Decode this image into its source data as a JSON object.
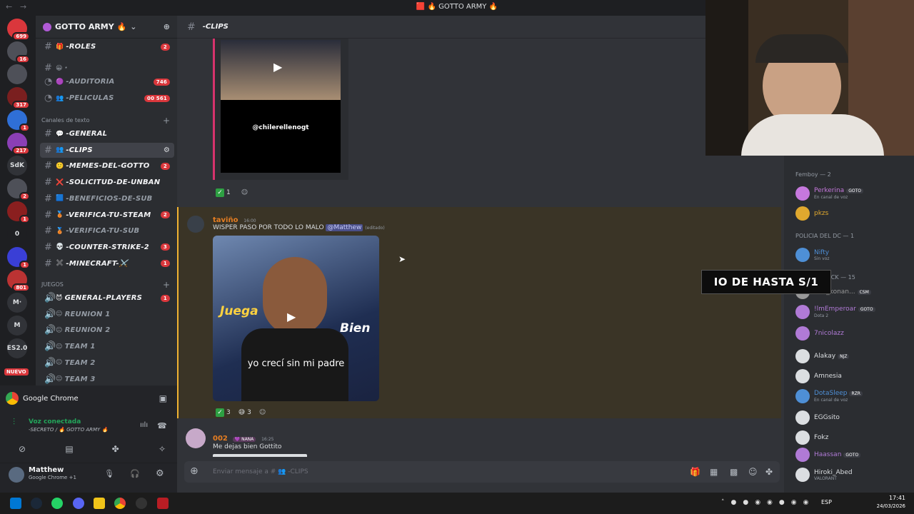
{
  "window_title": "🟥 🔥 GOTTO ARMY 🔥",
  "guilds": [
    {
      "label": "",
      "badge": "699",
      "color": "#da373c"
    },
    {
      "label": "",
      "badge": "16",
      "color": "#4e5058"
    },
    {
      "label": "",
      "badge": "",
      "color": "#4e5058"
    },
    {
      "label": "",
      "badge": "317",
      "color": "#7a1f1f"
    },
    {
      "label": "",
      "badge": "1",
      "color": "#2f6fd6"
    },
    {
      "label": "",
      "badge": "217",
      "color": "#8b3fb5"
    },
    {
      "label": "SdK",
      "badge": "",
      "color": "#313338"
    },
    {
      "label": "",
      "badge": "2",
      "color": "#4e5058"
    },
    {
      "label": "",
      "badge": "1",
      "color": "#8a1f1f"
    },
    {
      "label": "0",
      "badge": "",
      "color": "#1e1f22"
    },
    {
      "label": "",
      "badge": "1",
      "color": "#3a3fd6"
    },
    {
      "label": "",
      "badge": "801",
      "color": "#b33"
    },
    {
      "label": "M·",
      "badge": "",
      "color": "#313338"
    },
    {
      "label": "M",
      "badge": "",
      "color": "#313338"
    },
    {
      "label": "ES2.0",
      "badge": "",
      "color": "#313338"
    }
  ],
  "nuevo_label": "NUEVO",
  "server": {
    "name": "GOTTO ARMY 🔥",
    "header_emoji": "🔥"
  },
  "channels": [
    {
      "icon": "#",
      "emo": "🎁",
      "name": "-ROLES",
      "count": "2",
      "bright": true
    },
    {
      "icon": "",
      "emo": "😀",
      "name": "·",
      "count": "",
      "bright": false
    },
    {
      "icon": "◔",
      "emo": "🟣",
      "name": "-AUDITORIA",
      "count": "746",
      "bright": false
    },
    {
      "icon": "◔",
      "emo": "👥",
      "name": "-PELICULAS",
      "count": "00  561",
      "bright": false
    }
  ],
  "text_category": "Canales de texto",
  "text_channels": [
    {
      "emo": "💬",
      "name": "-GENERAL",
      "count": "",
      "bright": true
    },
    {
      "emo": "👥",
      "name": "-CLIPS",
      "count": "",
      "bright": true,
      "active": true
    },
    {
      "emo": "🙂",
      "name": "-MEMES-DEL-GOTTO",
      "count": "2",
      "bright": true
    },
    {
      "emo": "❌",
      "name": "-SOLICITUD-DE-UNBAN",
      "count": "",
      "bright": true
    },
    {
      "emo": "🟦",
      "name": "-BENEFICIOS-DE-SUB",
      "count": "",
      "bright": false
    },
    {
      "emo": "🥉",
      "name": "-VERIFICA-TU-STEAM",
      "count": "2",
      "bright": true
    },
    {
      "emo": "🥉",
      "name": "-VERIFICA-TU-SUB",
      "count": "",
      "bright": false
    },
    {
      "emo": "💀",
      "name": "-COUNTER-STRIKE-2",
      "count": "3",
      "bright": true
    },
    {
      "emo": "✖️",
      "name": "-MINECRAFT-⚔️",
      "count": "1",
      "bright": true
    }
  ],
  "games_category": "JUEGOS",
  "voice_channels": [
    {
      "emo": "😈",
      "name": "GENERAL-PLAYERS",
      "count": "1",
      "bright": true
    },
    {
      "emo": "😐",
      "name": "REUNION 1",
      "count": "",
      "bright": false
    },
    {
      "emo": "😐",
      "name": "REUNION 2",
      "count": "",
      "bright": false
    },
    {
      "emo": "😐",
      "name": "TEAM 1",
      "count": "",
      "bright": false
    },
    {
      "emo": "😐",
      "name": "TEAM 2",
      "count": "",
      "bright": false
    },
    {
      "emo": "😐",
      "name": "TEAM 3",
      "count": "",
      "bright": false
    }
  ],
  "activity": {
    "app": "Google Chrome"
  },
  "voice": {
    "status": "Voz conectada",
    "channel": "-SECRETO / 🔥 GOTTO ARMY 🔥"
  },
  "user": {
    "name": "Matthew",
    "status": "Google Chrome +1"
  },
  "chat": {
    "channel": "-CLIPS",
    "clip1_watermark": "@chilerellenogt",
    "react1_count": "1",
    "msg2": {
      "author": "taviño",
      "time": "16:00",
      "text": "WISPER PASO POR TODO LO MALO",
      "mention": "@Matthew",
      "edited": "(editado)"
    },
    "video2": {
      "left": "Juega",
      "right": "Bien",
      "caption": "yo crecí sin mi padre"
    },
    "react2_a": "3",
    "react2_b": "3",
    "msg3": {
      "author": "002",
      "tag": "💜 NANA",
      "time": "16:25",
      "text": "Me dejas bien Gottito"
    },
    "input_placeholder": "Enviar mensaje a # 👥 -CLIPS"
  },
  "overlay_text": "IO DE HASTA S/1",
  "members": {
    "cat1": "Femboy — 2",
    "cat2": "POLICIA DEL DC — 1",
    "cat3": "RIPTORES KICK — 15",
    "list": [
      {
        "name": "Perkerina",
        "tag": "GOTO",
        "sub": "En canal de voz",
        "color": "#c678dd"
      },
      {
        "name": "pkzs",
        "tag": "",
        "sub": "",
        "color": "#e0a82e"
      },
      {
        "name": "Nifty",
        "tag": "",
        "sub": "Sin voz",
        "color": "#4e8fd6"
      },
      {
        "name": "848_konan...",
        "tag": "CSM",
        "sub": "",
        "color": "#999"
      },
      {
        "name": "!lmEmperoar",
        "tag": "GOTO",
        "sub": "Dota 2",
        "color": "#b07ad6"
      },
      {
        "name": "7nicolazz",
        "tag": "",
        "sub": "",
        "color": "#b07ad6"
      },
      {
        "name": "Alakay",
        "tag": "NJZ",
        "sub": "",
        "color": "#dbdee1"
      },
      {
        "name": "Amnesia",
        "tag": "",
        "sub": "",
        "color": "#dbdee1"
      },
      {
        "name": "DotaSleep",
        "tag": "RZR",
        "sub": "En canal de voz",
        "color": "#4e8fd6"
      },
      {
        "name": "EGGsito",
        "tag": "",
        "sub": "",
        "color": "#dbdee1"
      },
      {
        "name": "Fokz",
        "tag": "",
        "sub": "",
        "color": "#dbdee1"
      },
      {
        "name": "Haassan",
        "tag": "GOTO",
        "sub": "",
        "color": "#b07ad6"
      },
      {
        "name": "Hiroki_Abed",
        "tag": "",
        "sub": "VALORANT",
        "color": "#dbdee1"
      }
    ]
  },
  "taskbar": {
    "time": "17:41",
    "date": "24/03/2026",
    "lang": "ESP"
  }
}
